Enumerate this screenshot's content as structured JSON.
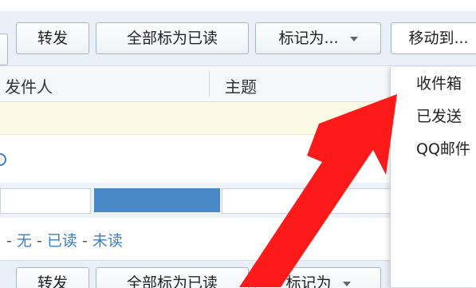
{
  "toolbar": {
    "forward_label": "转发",
    "mark_all_read_label": "全部标为已读",
    "mark_as_label": "标记为...",
    "move_to_label": "移动到..."
  },
  "columns": {
    "sender": "发件人",
    "subject": "主题"
  },
  "filter": {
    "dash1": "-",
    "none": "无",
    "dash2": "-",
    "read": "已读",
    "dash3": "-",
    "unread": "未读"
  },
  "bottom_toolbar": {
    "forward_label": "转发",
    "mark_all_read_label": "全部标为已读",
    "mark_as_label": "标记为"
  },
  "move_menu": {
    "items": [
      "收件箱",
      "已发送",
      "QQ邮件"
    ]
  },
  "colors": {
    "accent": "#3d7fc4",
    "selected_row": "#fdfbe6",
    "arrow": "#ff1a1a"
  }
}
